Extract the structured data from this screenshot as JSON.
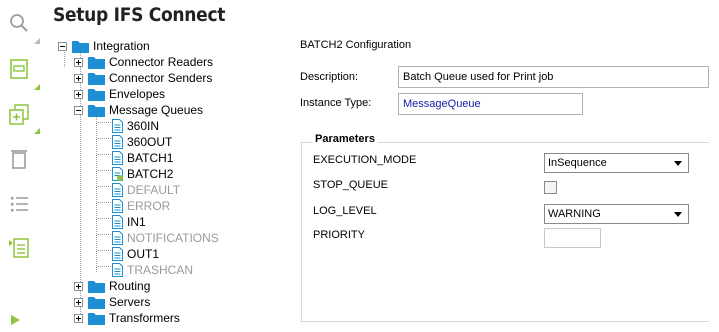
{
  "page": {
    "title": "Setup IFS Connect"
  },
  "toolbar": {
    "icons": [
      "search-icon",
      "new-icon",
      "duplicate-icon",
      "delete-icon",
      "list-icon",
      "details-icon",
      "play-icon"
    ]
  },
  "tree": {
    "root": "Integration",
    "groups": {
      "connector_readers": "Connector Readers",
      "connector_senders": "Connector Senders",
      "envelopes": "Envelopes",
      "message_queues": "Message Queues",
      "routing": "Routing",
      "servers": "Servers",
      "transformers": "Transformers"
    },
    "queues": [
      {
        "label": "360IN",
        "disabled": false
      },
      {
        "label": "360OUT",
        "disabled": false
      },
      {
        "label": "BATCH1",
        "disabled": false
      },
      {
        "label": "BATCH2",
        "disabled": false
      },
      {
        "label": "DEFAULT",
        "disabled": true
      },
      {
        "label": "ERROR",
        "disabled": true
      },
      {
        "label": "IN1",
        "disabled": false
      },
      {
        "label": "NOTIFICATIONS",
        "disabled": true
      },
      {
        "label": "OUT1",
        "disabled": false
      },
      {
        "label": "TRASHCAN",
        "disabled": true
      }
    ]
  },
  "config": {
    "title": "BATCH2 Configuration",
    "description_label": "Description:",
    "description_value": "Batch Queue used for Print job",
    "instance_type_label": "Instance Type:",
    "instance_type_value": "MessageQueue"
  },
  "parameters": {
    "title": "Parameters",
    "execution_mode_label": "EXECUTION_MODE",
    "execution_mode_value": "InSequence",
    "stop_queue_label": "STOP_QUEUE",
    "stop_queue_checked": false,
    "log_level_label": "LOG_LEVEL",
    "log_level_value": "WARNING",
    "priority_label": "PRIORITY",
    "priority_value": ""
  },
  "colors": {
    "folder": "#1d8fd6",
    "accent_green": "#8cc63e",
    "link": "#1a1aa6",
    "disabled_text": "#9a9a9a"
  }
}
